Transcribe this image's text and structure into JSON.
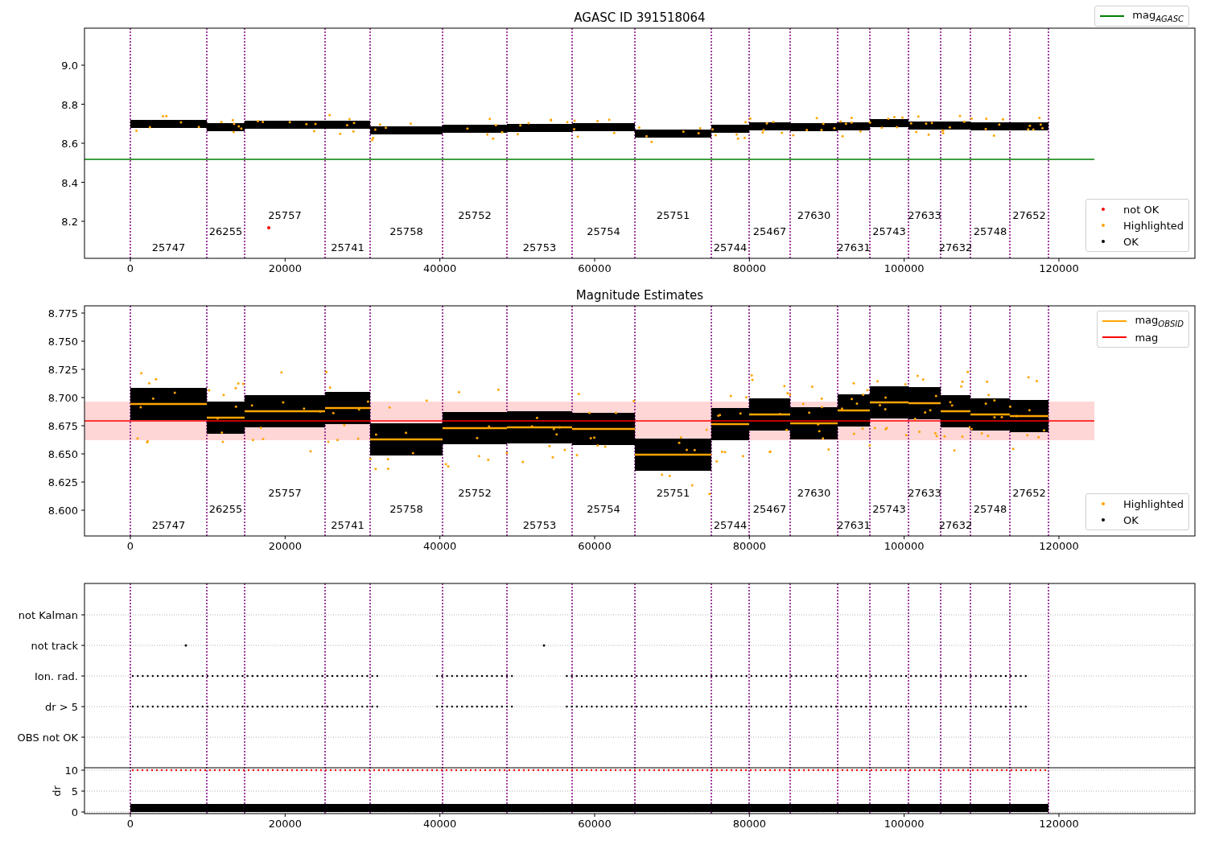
{
  "figure": {
    "panels": [
      {
        "kind": "magnitude",
        "title": "AGASC ID 391518064",
        "yticks": [
          "9.0",
          "8.8",
          "8.6",
          "8.4",
          "8.2"
        ],
        "xticks": [
          "0",
          "20000",
          "40000",
          "60000",
          "80000",
          "100000",
          "120000"
        ],
        "obsids": [
          "25747",
          "26255",
          "25757",
          "25741",
          "25758",
          "25752",
          "25753",
          "25754",
          "25751",
          "25744",
          "25467",
          "27630",
          "27631",
          "25743",
          "27633",
          "27632",
          "25748",
          "27652"
        ],
        "legends": [
          {
            "entries": [
              {
                "kind": "line",
                "label": "mag$_{AGASC}$",
                "color": "#008000"
              }
            ]
          },
          {
            "entries": [
              {
                "kind": "dot",
                "label": "not OK",
                "color": "#ff0000"
              },
              {
                "kind": "dot",
                "label": "Highlighted",
                "color": "#ffa500"
              },
              {
                "kind": "dot",
                "label": "OK",
                "color": "#000000"
              }
            ]
          }
        ]
      },
      {
        "kind": "estimates",
        "title": "Magnitude Estimates",
        "yticks": [
          "8.775",
          "8.750",
          "8.725",
          "8.700",
          "8.675",
          "8.650",
          "8.625",
          "8.600"
        ],
        "xticks": [
          "0",
          "20000",
          "40000",
          "60000",
          "80000",
          "100000",
          "120000"
        ],
        "obsids": [
          "25747",
          "26255",
          "25757",
          "25741",
          "25758",
          "25752",
          "25753",
          "25754",
          "25751",
          "25744",
          "25467",
          "27630",
          "27631",
          "25743",
          "27633",
          "27632",
          "25748",
          "27652"
        ],
        "legends": [
          {
            "entries": [
              {
                "kind": "line",
                "label": "mag$_{OBSID}$",
                "color": "#ffa500"
              },
              {
                "kind": "line",
                "label": "mag",
                "color": "#ff0000"
              }
            ]
          },
          {
            "entries": [
              {
                "kind": "dot",
                "label": "Highlighted",
                "color": "#ffa500"
              },
              {
                "kind": "dot",
                "label": "OK",
                "color": "#000000"
              }
            ]
          }
        ]
      },
      {
        "kind": "flags",
        "yticks": [
          "not Kalman",
          "not track",
          "Ion. rad.",
          "dr > 5",
          "OBS not OK"
        ],
        "dr_ticks": [
          "10",
          "5",
          "0"
        ],
        "ylabel": "dr",
        "xticks": [
          "0",
          "20000",
          "40000",
          "60000",
          "80000",
          "100000",
          "120000"
        ]
      }
    ]
  }
}
